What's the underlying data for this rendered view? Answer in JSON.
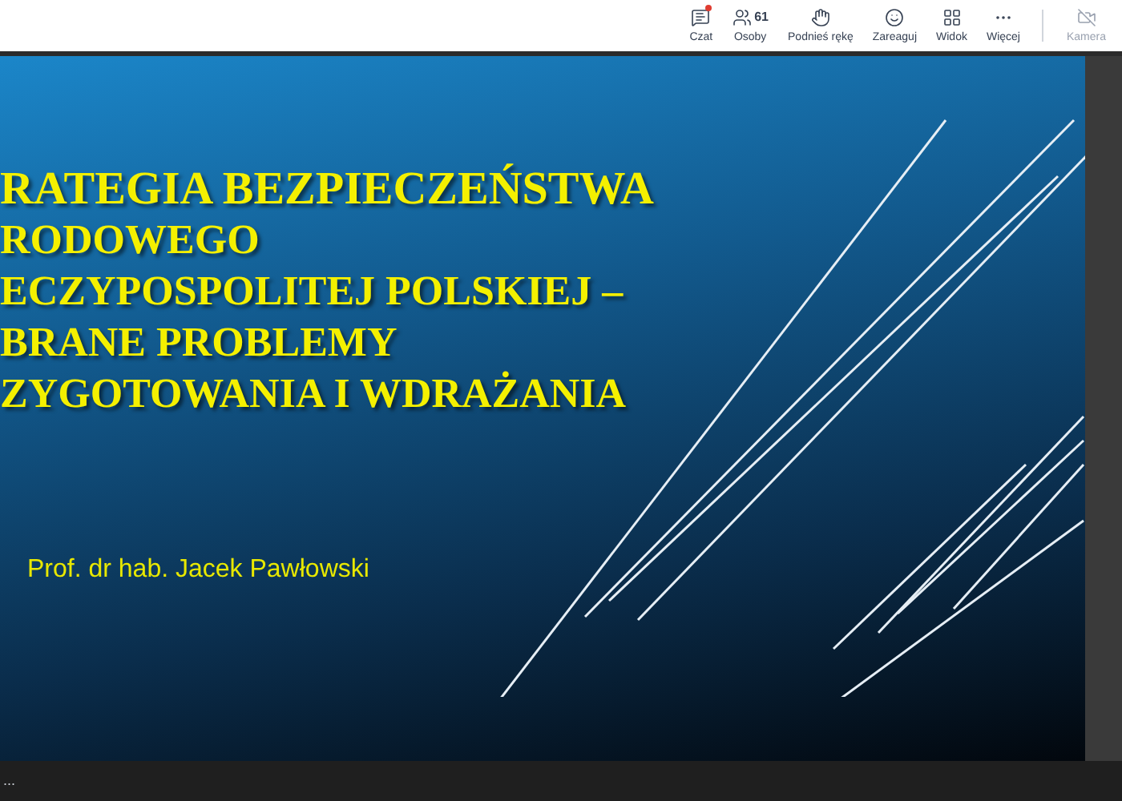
{
  "toolbar": {
    "items": [
      {
        "kind": "chat",
        "label": "Czat",
        "notification": true,
        "disabled": false
      },
      {
        "kind": "people",
        "label": "Osoby",
        "count": "61",
        "notification": false,
        "disabled": false
      },
      {
        "kind": "hand",
        "label": "Podnieś rękę",
        "notification": false,
        "disabled": false
      },
      {
        "kind": "react",
        "label": "Zareaguj",
        "notification": false,
        "disabled": false
      },
      {
        "kind": "view",
        "label": "Widok",
        "notification": false,
        "disabled": false
      },
      {
        "kind": "more",
        "label": "Więcej",
        "notification": false,
        "disabled": false
      },
      {
        "kind": "camera",
        "label": "Kamera",
        "notification": false,
        "disabled": true
      }
    ]
  },
  "slide": {
    "title_lines": [
      "RATEGIA BEZPIECZEŃSTWA",
      "RODOWEGO",
      "ECZYPOSPOLITEJ POLSKIEJ –",
      "BRANE PROBLEMY",
      "ZYGOTOWANIA I WDRAŻANIA"
    ],
    "author": "Prof. dr hab. Jacek Pawłowski"
  },
  "bottom_bar": {
    "text": "..."
  }
}
